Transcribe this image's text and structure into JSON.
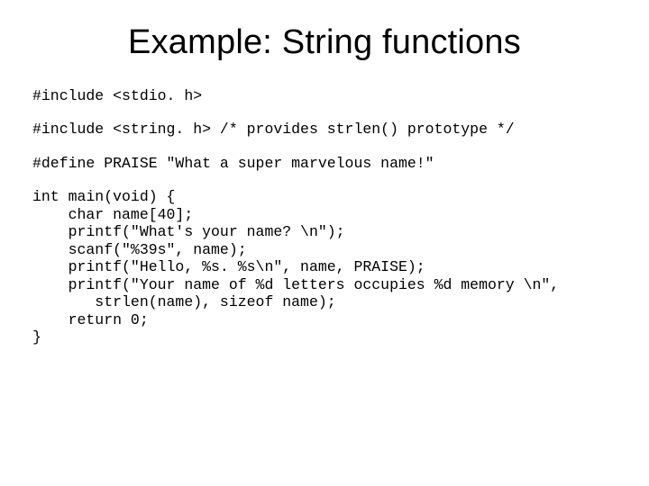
{
  "title": "Example: String functions",
  "code": {
    "line1": "#include <stdio. h>",
    "line2": "#include <string. h> /* provides strlen() prototype */",
    "line3": "#define PRAISE \"What a super marvelous name!\"",
    "main": "int main(void) {\n    char name[40];\n    printf(\"What's your name? \\n\");\n    scanf(\"%39s\", name);\n    printf(\"Hello, %s. %s\\n\", name, PRAISE);\n    printf(\"Your name of %d letters occupies %d memory \\n\",\n       strlen(name), sizeof name);\n    return 0;\n}"
  }
}
